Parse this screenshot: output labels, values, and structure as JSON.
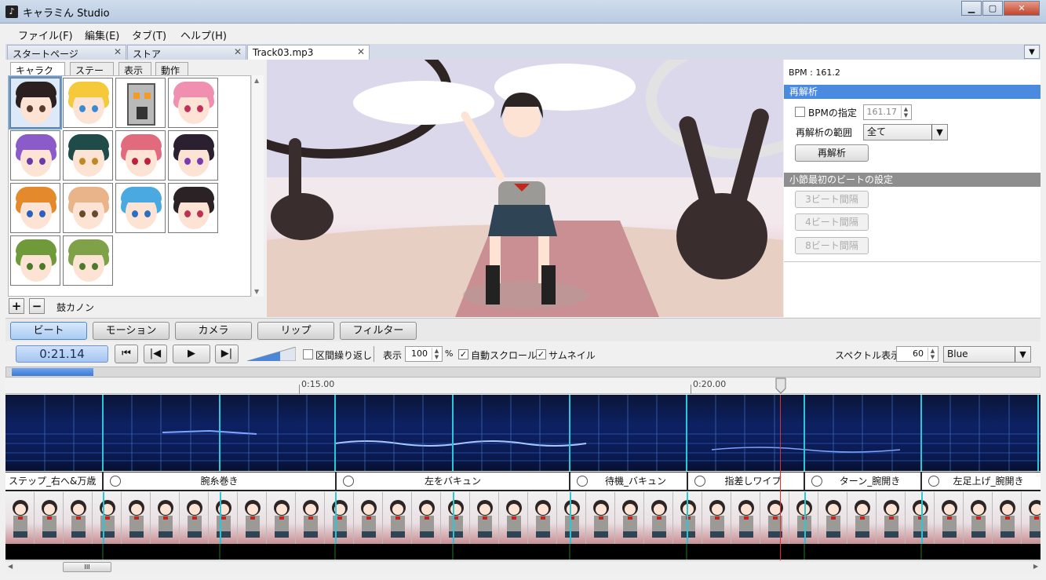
{
  "window": {
    "title": "キャラミん Studio"
  },
  "menu": [
    "ファイル(F)",
    "編集(E)",
    "タブ(T)",
    "ヘルプ(H)"
  ],
  "doc_tabs": [
    {
      "label": "スタートページ",
      "active": false
    },
    {
      "label": "ストア",
      "active": false
    },
    {
      "label": "Track03.mp3",
      "active": true
    }
  ],
  "left_panel": {
    "tabs": [
      "キャラクター",
      "ステージ",
      "表示",
      "動作"
    ],
    "selected_name": "鼓カノン",
    "add_label": "+",
    "remove_label": "−"
  },
  "right_panel": {
    "bpm_text": "BPM : 161.2",
    "reanalyze_header": "再解析",
    "bpm_spec_label": "BPMの指定",
    "bpm_spec_value": "161.17",
    "range_label": "再解析の範囲",
    "range_value": "全て",
    "reanalyze_button": "再解析",
    "beat_header": "小節最初のビートの設定",
    "beat_buttons": [
      "3ビート間隔",
      "4ビート間隔",
      "8ビート間隔"
    ],
    "colors": {
      "section_active": "#4a8be0",
      "section_inactive": "#8e8e8e"
    }
  },
  "mode_tabs": [
    "ビート",
    "モーション",
    "カメラ",
    "リップ",
    "フィルター"
  ],
  "transport": {
    "time": "0:21.14",
    "loop_label": "区間繰り返し",
    "display_label": "表示",
    "zoom_value": "100",
    "zoom_unit": "%",
    "autoscroll_label": "自動スクロール",
    "thumbnail_label": "サムネイル",
    "spectrum_label": "スペクトル表示",
    "spectrum_value": "60",
    "color_scheme": "Blue"
  },
  "timeline": {
    "ruler_labels": [
      "0:15.00",
      "0:20.00"
    ],
    "motions": [
      "ステップ_右へ&万歳",
      "腕糸巻き",
      "左をバキュン",
      "待機_バキュン",
      "指差しワイプ",
      "ターン_腕開き",
      "左足上げ_腕開き"
    ]
  },
  "scroll_grip": "III"
}
